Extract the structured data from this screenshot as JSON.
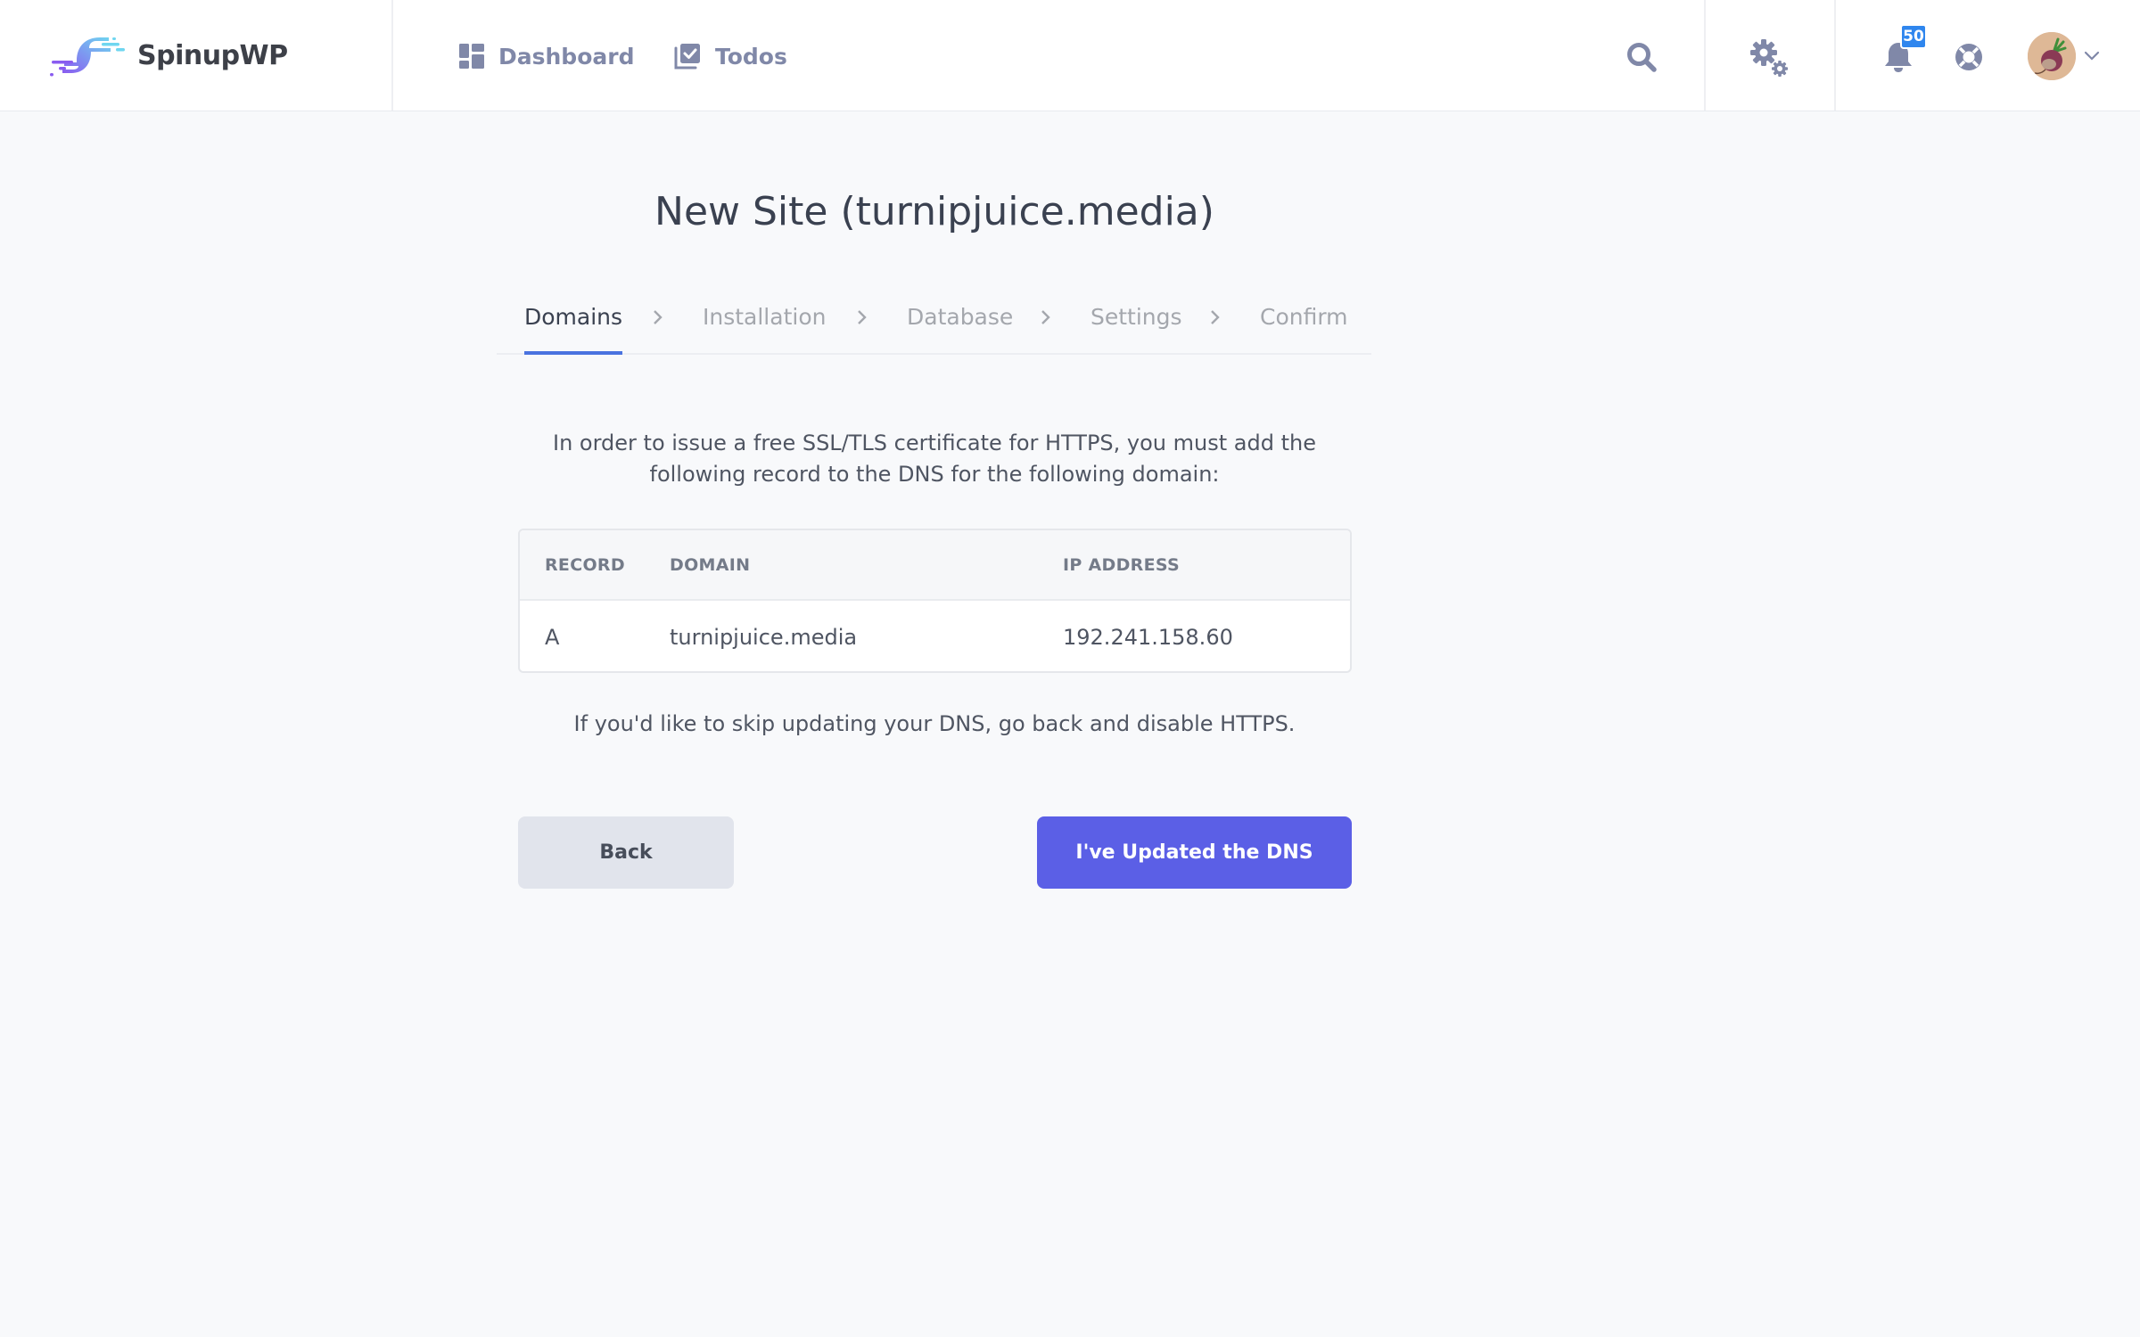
{
  "header": {
    "brand": "SpinupWP",
    "nav": [
      {
        "label": "Dashboard",
        "icon": "dashboard-icon"
      },
      {
        "label": "Todos",
        "icon": "todos-icon"
      }
    ],
    "icons": {
      "search": "search-icon",
      "settings": "gears-icon",
      "notifications": "bell-icon",
      "help": "lifebuoy-icon",
      "account_menu": "chevron-down-icon"
    },
    "notification_count": "50",
    "colors": {
      "icon": "#8088a8",
      "badge": "#2f86ee"
    }
  },
  "page": {
    "title": "New Site (turnipjuice.media)",
    "steps": [
      {
        "label": "Domains",
        "active": true
      },
      {
        "label": "Installation",
        "active": false
      },
      {
        "label": "Database",
        "active": false
      },
      {
        "label": "Settings",
        "active": false
      },
      {
        "label": "Confirm",
        "active": false
      }
    ],
    "intro": "In order to issue a free SSL/TLS certificate for HTTPS, you must add the following record to the DNS for the following domain:",
    "table": {
      "headers": [
        "RECORD",
        "DOMAIN",
        "IP ADDRESS"
      ],
      "rows": [
        [
          "A",
          "turnipjuice.media",
          "192.241.158.60"
        ]
      ]
    },
    "skip_note": "If you'd like to skip updating your DNS, go back and disable HTTPS.",
    "buttons": {
      "back": "Back",
      "confirm": "I've Updated the DNS"
    },
    "colors": {
      "accent": "#5b5fe6",
      "active_step_underline": "#4a73e0",
      "background": "#f8f9fb"
    }
  }
}
